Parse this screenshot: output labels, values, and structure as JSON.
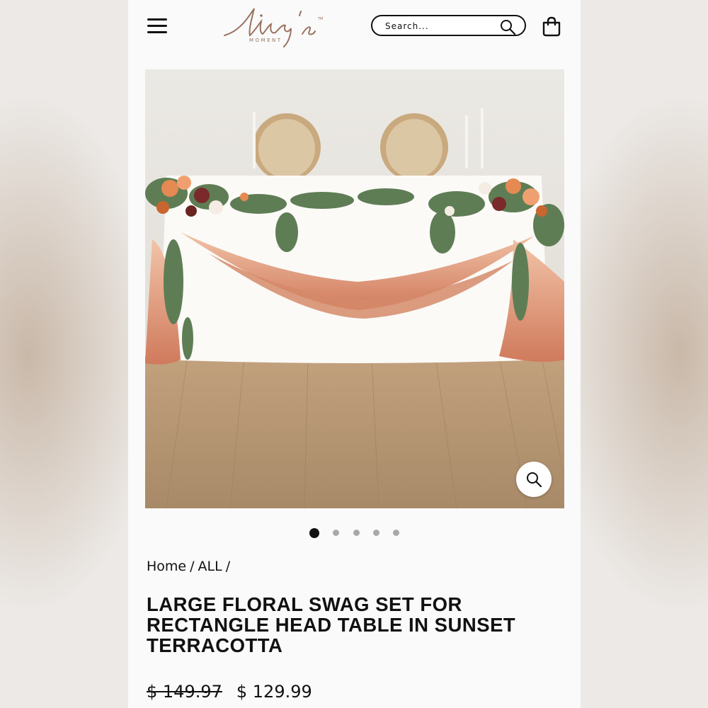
{
  "header": {
    "logo_text": "ling's",
    "logo_subtext": "MOMENT",
    "logo_tm": "TM",
    "menu_icon": "hamburger-menu-icon",
    "search_icon": "search-icon",
    "cart_icon": "shopping-bag-icon"
  },
  "search": {
    "placeholder": "Search..."
  },
  "gallery": {
    "image_alt": "Floral swag set on rectangle head table with terracotta drapes",
    "zoom_icon": "zoom-search-icon",
    "active_index": 0
  },
  "breadcrumb": [
    "Home",
    "/",
    "ALL",
    "/"
  ],
  "product": {
    "title": "LARGE FLORAL SWAG SET FOR RECTANGLE HEAD TABLE IN SUNSET TERRACOTTA",
    "old_price": "$ 149.97",
    "price": "$ 129.99"
  },
  "colors": {
    "accent": "#111111",
    "logo": "#9a7361",
    "drape": "#d9876a"
  }
}
